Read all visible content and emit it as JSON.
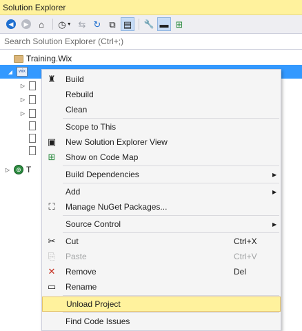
{
  "title": "Solution Explorer",
  "toolbar": {
    "buttons": [
      {
        "name": "back-icon",
        "glyph": "◀"
      },
      {
        "name": "forward-icon",
        "glyph": "▶"
      },
      {
        "name": "home-icon",
        "glyph": "⌂"
      },
      {
        "name": "history-icon",
        "glyph": "◷"
      },
      {
        "name": "sync-icon",
        "glyph": "⇆"
      },
      {
        "name": "refresh-icon",
        "glyph": "↻"
      },
      {
        "name": "collapse-all-icon",
        "glyph": "⧉"
      },
      {
        "name": "show-all-files-icon",
        "glyph": "▤"
      },
      {
        "name": "properties-icon",
        "glyph": "🔧"
      },
      {
        "name": "preview-icon",
        "glyph": "▬"
      },
      {
        "name": "code-map-icon",
        "glyph": "⊞"
      }
    ]
  },
  "search": {
    "placeholder": "Search Solution Explorer (Ctrl+;)"
  },
  "tree": {
    "solution_label": "Training.Wix",
    "last_label": "T"
  },
  "menu": {
    "items": [
      {
        "label": "Build",
        "icon": "build-icon",
        "glyph": "♜"
      },
      {
        "label": "Rebuild"
      },
      {
        "label": "Clean"
      },
      {
        "label": "Scope to This"
      },
      {
        "label": "New Solution Explorer View",
        "icon": "new-view-icon",
        "glyph": "▣"
      },
      {
        "label": "Show on Code Map",
        "icon": "code-map-icon",
        "glyph": "⊞"
      },
      {
        "label": "Build Dependencies",
        "submenu": true
      },
      {
        "label": "Add",
        "submenu": true
      },
      {
        "label": "Manage NuGet Packages...",
        "icon": "nuget-icon",
        "glyph": "⛶"
      },
      {
        "label": "Source Control",
        "submenu": true
      },
      {
        "label": "Cut",
        "shortcut": "Ctrl+X",
        "icon": "cut-icon",
        "glyph": "✂"
      },
      {
        "label": "Paste",
        "shortcut": "Ctrl+V",
        "icon": "paste-icon",
        "glyph": "📋",
        "disabled": true
      },
      {
        "label": "Remove",
        "shortcut": "Del",
        "icon": "remove-icon",
        "glyph": "✕"
      },
      {
        "label": "Rename",
        "icon": "rename-icon",
        "glyph": "▭"
      },
      {
        "label": "Unload Project",
        "highlighted": true
      },
      {
        "label": "Find Code Issues"
      }
    ]
  },
  "colors": {
    "title_bg": "#fff29d",
    "selection": "#3399ff",
    "menu_highlight": "#fff29d"
  }
}
